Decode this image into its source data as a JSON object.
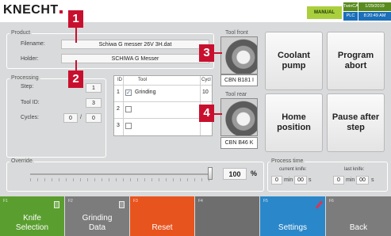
{
  "header": {
    "logo": "KNECHT",
    "mode": "MANUAL",
    "status": [
      {
        "label": "TwinCAT",
        "value": "1/29/2019"
      },
      {
        "label": "PLC",
        "value": "8:20:49 AM"
      }
    ]
  },
  "product": {
    "title": "Product",
    "filename_label": "Filename:",
    "filename_value": "Schiwa G messer 26V 3H.dat",
    "holder_label": "Holder:",
    "holder_value": "SCHIWA G Messer"
  },
  "processing": {
    "title": "Processing",
    "step_label": "Step:",
    "step_value": "1",
    "tool_id_label": "Tool ID:",
    "tool_id_value": "3",
    "cycles_label": "Cycles:",
    "cycles_current": "0",
    "cycles_sep": "/",
    "cycles_total": "0"
  },
  "tool_table": {
    "columns": [
      "ID",
      "Tool",
      "Cycl"
    ],
    "rows": [
      {
        "id": "1",
        "checked": true,
        "check_mark": "✓",
        "tool": "Grinding",
        "cycles": "10"
      },
      {
        "id": "2",
        "checked": false,
        "check_mark": "",
        "tool": "",
        "cycles": ""
      },
      {
        "id": "3",
        "checked": false,
        "check_mark": "",
        "tool": "",
        "cycles": ""
      }
    ]
  },
  "tool_front": {
    "title": "Tool front",
    "caption": "CBN B181 I"
  },
  "tool_rear": {
    "title": "Tool rear",
    "caption": "CBN B46 K"
  },
  "buttons": {
    "coolant_pump": "Coolant pump",
    "program_abort": "Program abort",
    "home_position": "Home position",
    "pause_after_step": "Pause after step"
  },
  "override": {
    "title": "Override",
    "value": "100",
    "unit": "%",
    "level_percent": 100
  },
  "process_time": {
    "title": "Process time",
    "current_label": "current knife:",
    "current_min": "0",
    "current_sec": "00",
    "last_label": "last knife:",
    "last_min": "0",
    "last_sec": "00",
    "min_unit": "min",
    "sec_unit": "s"
  },
  "markers": [
    "1",
    "2",
    "3",
    "4"
  ],
  "fkeys": [
    {
      "num": "F1",
      "label": "Knife Selection",
      "color": "#5a9e2f",
      "icon": "document-icon"
    },
    {
      "num": "F2",
      "label": "Grinding Data",
      "color": "#7c7c7c",
      "icon": "document-icon"
    },
    {
      "num": "F3",
      "label": "Reset",
      "color": "#e8541e",
      "icon": ""
    },
    {
      "num": "F4",
      "label": "",
      "color": "#6e6e6e",
      "icon": ""
    },
    {
      "num": "F5",
      "label": "Settings",
      "color": "#2a87c9",
      "icon": "pencil-icon"
    },
    {
      "num": "F6",
      "label": "Back",
      "color": "#7c7c7c",
      "icon": ""
    }
  ]
}
